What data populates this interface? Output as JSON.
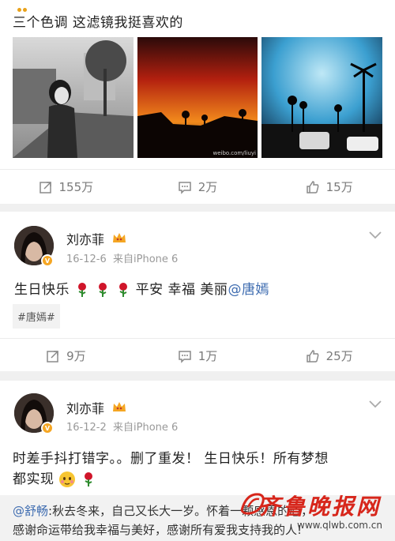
{
  "post1": {
    "text": "三个色调 这滤镜我挺喜欢的",
    "watermark": "weibo.com/liuyi",
    "actions": {
      "repost": "155万",
      "comment": "2万",
      "like": "15万"
    }
  },
  "post2": {
    "author": "刘亦菲",
    "date": "16-12-6",
    "source": "来自iPhone 6",
    "text_before": "生日快乐",
    "text_after": "平安 幸福 美丽",
    "mention": "@唐嫣",
    "topic": "#唐嫣#",
    "actions": {
      "repost": "9万",
      "comment": "1万",
      "like": "25万"
    }
  },
  "post3": {
    "author": "刘亦菲",
    "date": "16-12-2",
    "source": "来自iPhone 6",
    "text_line1": "时差手抖打错字。。删了重发！ 生日快乐！所有梦想",
    "text_line2": "都实现",
    "repost_user": "@舒畅",
    "repost_line1": ":秋去冬来，自己又长大一岁。怀着一颗感恩的心，",
    "repost_line2": "感谢命运带给我幸福与美好，感谢所有爱我支持我的人!"
  },
  "site_watermark": {
    "title": "齐鲁晚报网",
    "url": "www.qlwb.com.cn"
  },
  "colors": {
    "link": "#3e6cb0",
    "badge": "#f5a623",
    "brand_red": "#d7261b"
  }
}
